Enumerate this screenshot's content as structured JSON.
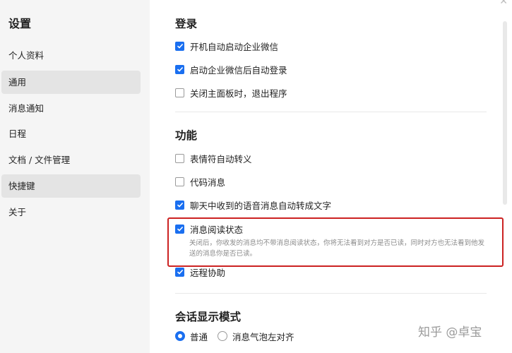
{
  "sidebar": {
    "title": "设置",
    "items": [
      {
        "label": "个人资料"
      },
      {
        "label": "通用"
      },
      {
        "label": "消息通知"
      },
      {
        "label": "日程"
      },
      {
        "label": "文档 / 文件管理"
      },
      {
        "label": "快捷键"
      },
      {
        "label": "关于"
      }
    ]
  },
  "login": {
    "title": "登录",
    "items": [
      {
        "label": "开机自动启动企业微信",
        "checked": true
      },
      {
        "label": "启动企业微信后自动登录",
        "checked": true
      },
      {
        "label": "关闭主面板时，退出程序",
        "checked": false
      }
    ]
  },
  "features": {
    "title": "功能",
    "items": [
      {
        "label": "表情符自动转义",
        "checked": false
      },
      {
        "label": "代码消息",
        "checked": false
      },
      {
        "label": "聊天中收到的语音消息自动转成文字",
        "checked": true
      },
      {
        "label": "消息阅读状态",
        "checked": true
      },
      {
        "label": "远程协助",
        "checked": true
      }
    ],
    "read_status_desc": "关闭后，你收发的消息均不带消息阅读状态，你将无法看到对方是否已读，同时对方也无法看到他发送的消息你是否已读。"
  },
  "display_mode": {
    "title": "会话显示模式",
    "options": [
      {
        "label": "普通",
        "selected": true
      },
      {
        "label": "消息气泡左对齐",
        "selected": false
      }
    ]
  },
  "watermark": "知乎 @卓宝",
  "colors": {
    "accent": "#1a6ff0",
    "highlight_border": "#cc2222"
  }
}
